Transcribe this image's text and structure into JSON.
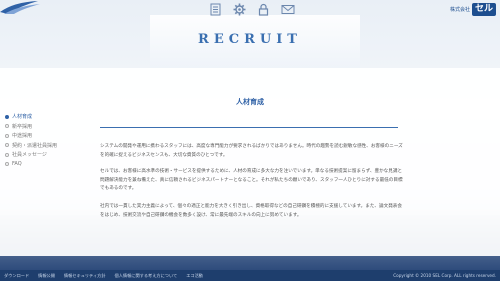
{
  "header": {
    "brand_prefix": "株式会社",
    "brand_name": "セル",
    "icons": [
      "document-icon",
      "gear-icon",
      "lock-icon",
      "mail-icon"
    ]
  },
  "page_heading": "RECRUIT",
  "sidebar": {
    "items": [
      {
        "label": "人材育成",
        "active": true
      },
      {
        "label": "新卒採用",
        "active": false
      },
      {
        "label": "中途採用",
        "active": false
      },
      {
        "label": "契約・派遣社員採用",
        "active": false
      },
      {
        "label": "社員メッセージ",
        "active": false
      },
      {
        "label": "FAQ",
        "active": false
      }
    ]
  },
  "content": {
    "title": "人材育成",
    "paragraphs": [
      "システムの開発や運用に携わるスタッフには、高度な専門能力が要求されるばかりではありません。時代の趨勢を読む鋭敏な感性、お客様のニーズを的確に捉えるビジネスセンスも、大切な資質のひとつです。",
      "セルでは、お客様に高水準の技術・サービスを提供するために、人材の育成に多大な力を注いでいます。単なる技術提案に留まらず、豊かな見識と問題解決能力を兼ね備えた、真に信頼されるビジネスパートナーとなること。それが私たちの願いであり、スタッフ一人ひとりに対する最低の目標でもあるのです。",
      "社内では一貫した実力主義によって、個々の適正と能力を大きく引き出し、資格取得などの自己研鑽を積極的に支援しています。また、論文発表会をはじめ、技術交流や自己研鑽の機会を数多く設け、常に最先端のスキルの向上に努めています。"
    ]
  },
  "footer": {
    "links": [
      "ダウンロード",
      "情報公開",
      "情報セキュリティ方針",
      "個人情報に関する考え方について",
      "エコ活動"
    ],
    "copyright": "Copyright © 2010 SEL Corp. ALL rights reserved."
  },
  "colors": {
    "accent": "#2f61a6",
    "footer_bg": "#1e3e6d",
    "brand": "#1d4e8f"
  }
}
